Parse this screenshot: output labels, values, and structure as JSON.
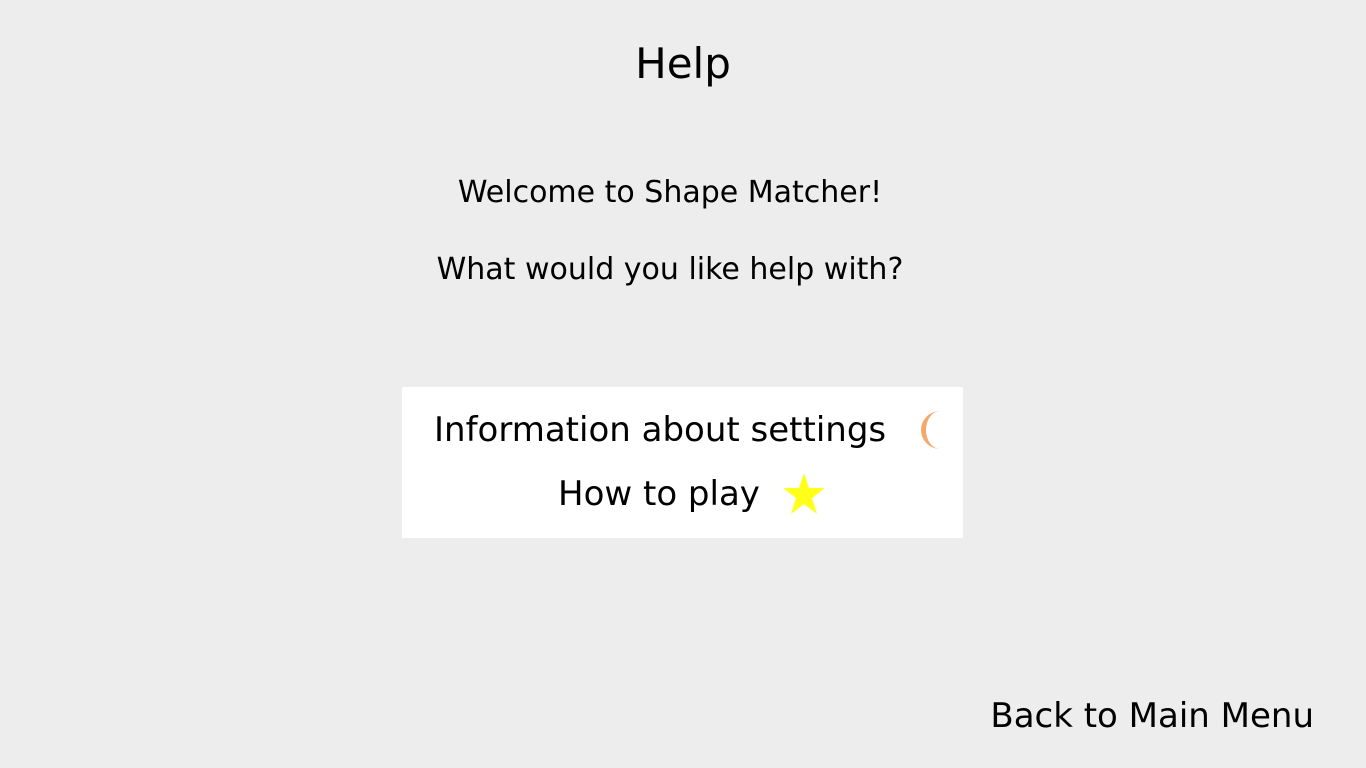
{
  "page": {
    "title": "Help",
    "welcome_text": "Welcome to Shape Matcher!",
    "question_text": "What would you like help with?"
  },
  "menu": {
    "items": [
      {
        "label": "Information about settings",
        "icon": "moon-icon",
        "icon_color": "#f5a86a"
      },
      {
        "label": "How to play",
        "icon": "star-icon",
        "icon_color": "#ffff1a"
      }
    ]
  },
  "footer": {
    "back_label": "Back to Main Menu"
  },
  "colors": {
    "background": "#ededed",
    "menu_background": "#ffffff",
    "text": "#000000"
  }
}
